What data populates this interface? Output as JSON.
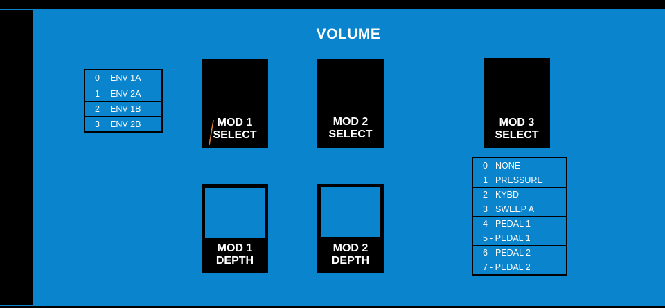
{
  "title": "VOLUME",
  "env_list": [
    {
      "num": "0",
      "label": "ENV 1A"
    },
    {
      "num": "1",
      "label": "ENV 2A"
    },
    {
      "num": "2",
      "label": "ENV 1B"
    },
    {
      "num": "3",
      "label": "ENV 2B"
    }
  ],
  "knobs": {
    "mod1_select": {
      "line1": "MOD 1",
      "line2": "SELECT"
    },
    "mod2_select": {
      "line1": "MOD 2",
      "line2": "SELECT"
    },
    "mod3_select": {
      "line1": "MOD 3",
      "line2": "SELECT"
    },
    "mod1_depth": {
      "line1": "MOD 1",
      "line2": "DEPTH"
    },
    "mod2_depth": {
      "line1": "MOD 2",
      "line2": "DEPTH"
    }
  },
  "mod3_list": [
    {
      "num": "0",
      "label": "NONE"
    },
    {
      "num": "1",
      "label": "PRESSURE"
    },
    {
      "num": "2",
      "label": "KYBD"
    },
    {
      "num": "3",
      "label": "SWEEP A"
    },
    {
      "num": "4",
      "label": "PEDAL 1"
    },
    {
      "num": "5",
      "label": "- PEDAL 1"
    },
    {
      "num": "6",
      "label": "PEDAL 2"
    },
    {
      "num": "7",
      "label": "- PEDAL 2"
    }
  ],
  "colors": {
    "panel": "#0a84cc",
    "knob": "#000000",
    "text": "#ffffff",
    "accent": "#d08030"
  }
}
